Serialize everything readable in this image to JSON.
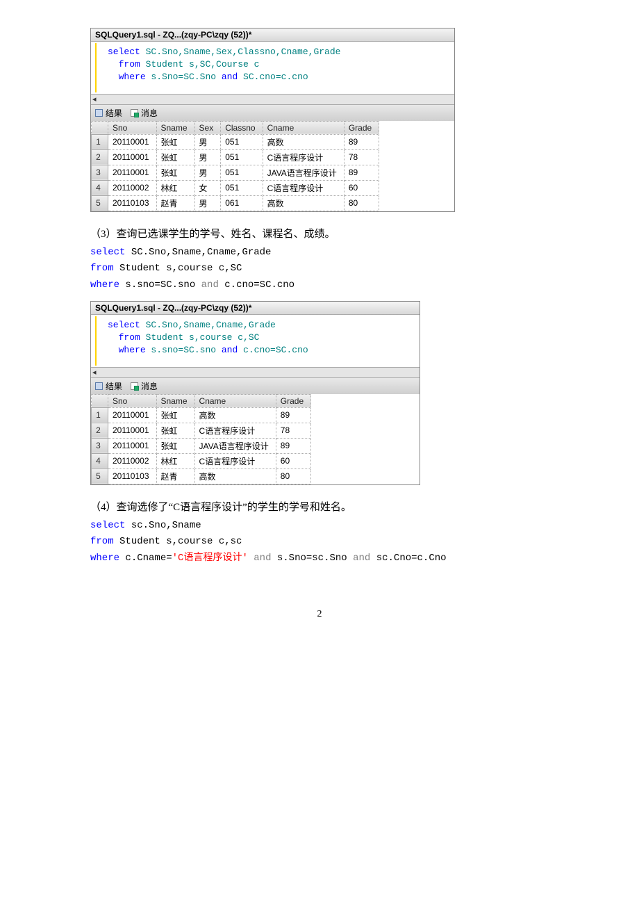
{
  "panel1": {
    "title": "SQLQuery1.sql - ZQ...(zqy-PC\\zqy (52))*",
    "sql": {
      "select": "select",
      "fields": " SC.Sno,Sname,Sex,Classno,Cname,Grade",
      "from": "from",
      "fromargs": " Student s,SC,Course c",
      "where": "where",
      "cond1": " s.Sno=SC.Sno ",
      "and": "and",
      "cond2": " SC.cno=c.cno"
    },
    "tabs": {
      "results": "结果",
      "messages": "消息"
    },
    "headers": [
      "",
      "Sno",
      "Sname",
      "Sex",
      "Classno",
      "Cname",
      "Grade"
    ],
    "rows": [
      [
        "1",
        "20110001",
        "张虹",
        "男",
        "051",
        "高数",
        "89"
      ],
      [
        "2",
        "20110001",
        "张虹",
        "男",
        "051",
        "C语言程序设计",
        "78"
      ],
      [
        "3",
        "20110001",
        "张虹",
        "男",
        "051",
        "JAVA语言程序设计",
        "89"
      ],
      [
        "4",
        "20110002",
        "林红",
        "女",
        "051",
        "C语言程序设计",
        "60"
      ],
      [
        "5",
        "20110103",
        "赵青",
        "男",
        "061",
        "高数",
        "80"
      ]
    ]
  },
  "q3": {
    "text": "（3）查询已选课学生的学号、姓名、课程名、成绩。",
    "code": [
      {
        "k": "select",
        "rest": " SC.Sno,Sname,Cname,Grade"
      },
      {
        "k": "from",
        "rest": " Student s,course c,SC"
      },
      {
        "k": "where",
        "rest1": " s.sno=SC.sno ",
        "and": "and",
        "rest2": " c.cno=SC.cno"
      }
    ]
  },
  "panel2": {
    "title": "SQLQuery1.sql - ZQ...(zqy-PC\\zqy (52))*",
    "sql": {
      "select": "select",
      "fields": " SC.Sno,Sname,Cname,Grade",
      "from": "from",
      "fromargs": " Student s,course c,SC",
      "where": "where",
      "cond1": " s.sno=SC.sno ",
      "and": "and",
      "cond2": " c.cno=SC.cno"
    },
    "tabs": {
      "results": "结果",
      "messages": "消息"
    },
    "headers": [
      "",
      "Sno",
      "Sname",
      "Cname",
      "Grade"
    ],
    "rows": [
      [
        "1",
        "20110001",
        "张虹",
        "高数",
        "89"
      ],
      [
        "2",
        "20110001",
        "张虹",
        "C语言程序设计",
        "78"
      ],
      [
        "3",
        "20110001",
        "张虹",
        "JAVA语言程序设计",
        "89"
      ],
      [
        "4",
        "20110002",
        "林红",
        "C语言程序设计",
        "60"
      ],
      [
        "5",
        "20110103",
        "赵青",
        "高数",
        "80"
      ]
    ]
  },
  "q4": {
    "text": "（4）查询选修了“C语言程序设计”的学生的学号和姓名。",
    "code": {
      "l1k": "select",
      "l1r": " sc.Sno,Sname",
      "l2k": "from",
      "l2r": " Student s,course c,sc",
      "l3k": "where",
      "l3a": " c.Cname=",
      "l3s": "'C语言程序设计'",
      "and1": " and",
      "l3b": " s.Sno=sc.Sno ",
      "and2": "and",
      "l3c": " sc.Cno=c.Cno"
    }
  },
  "page": "2"
}
